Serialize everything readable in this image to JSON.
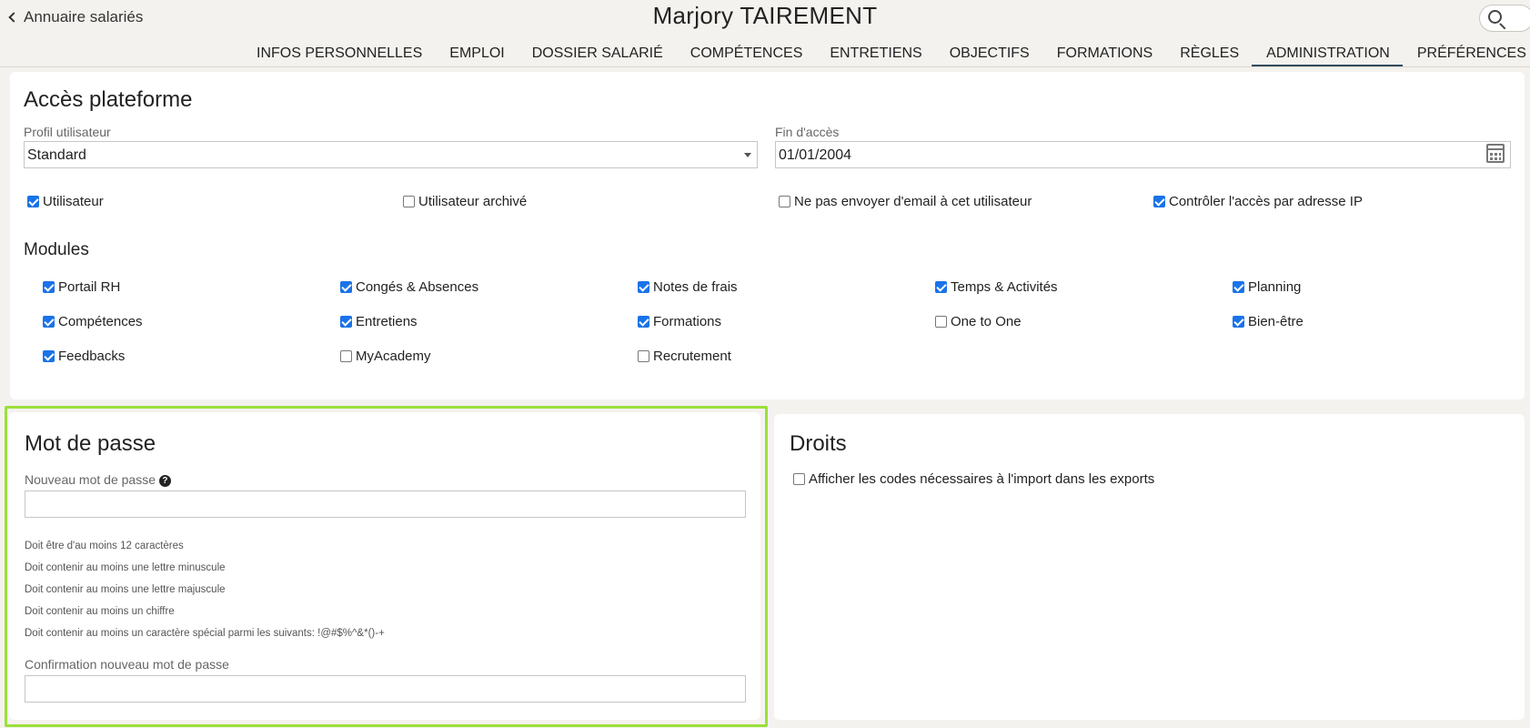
{
  "header": {
    "back_label": "Annuaire salariés",
    "person_name": "Marjory TAIREMENT",
    "tabs": [
      {
        "label": "INFOS PERSONNELLES",
        "active": false
      },
      {
        "label": "EMPLOI",
        "active": false
      },
      {
        "label": "DOSSIER SALARIÉ",
        "active": false
      },
      {
        "label": "COMPÉTENCES",
        "active": false
      },
      {
        "label": "ENTRETIENS",
        "active": false
      },
      {
        "label": "OBJECTIFS",
        "active": false
      },
      {
        "label": "FORMATIONS",
        "active": false
      },
      {
        "label": "RÈGLES",
        "active": false
      },
      {
        "label": "ADMINISTRATION",
        "active": true
      },
      {
        "label": "PRÉFÉRENCES",
        "active": false
      }
    ]
  },
  "access": {
    "title": "Accès plateforme",
    "profile_label": "Profil utilisateur",
    "profile_value": "Standard",
    "end_label": "Fin d'accès",
    "end_value": "01/01/2004",
    "options": [
      {
        "label": "Utilisateur",
        "checked": true
      },
      {
        "label": "Utilisateur archivé",
        "checked": false
      },
      {
        "label": "Ne pas envoyer d'email à cet utilisateur",
        "checked": false
      },
      {
        "label": "Contrôler l'accès par adresse IP",
        "checked": true
      }
    ],
    "modules_title": "Modules",
    "modules": [
      {
        "label": "Portail RH",
        "checked": true
      },
      {
        "label": "Congés & Absences",
        "checked": true
      },
      {
        "label": "Notes de frais",
        "checked": true
      },
      {
        "label": "Temps & Activités",
        "checked": true
      },
      {
        "label": "Planning",
        "checked": true
      },
      {
        "label": "Compétences",
        "checked": true
      },
      {
        "label": "Entretiens",
        "checked": true
      },
      {
        "label": "Formations",
        "checked": true
      },
      {
        "label": "One to One",
        "checked": false
      },
      {
        "label": "Bien-être",
        "checked": true
      },
      {
        "label": "Feedbacks",
        "checked": true
      },
      {
        "label": "MyAcademy",
        "checked": false
      },
      {
        "label": "Recrutement",
        "checked": false
      }
    ]
  },
  "password": {
    "title": "Mot de passe",
    "new_label": "Nouveau mot de passe",
    "new_value": "",
    "help_glyph": "?",
    "rules": [
      "Doit être d'au moins 12 caractères",
      "Doit contenir au moins une lettre minuscule",
      "Doit contenir au moins une lettre majuscule",
      "Doit contenir au moins un chiffre",
      "Doit contenir au moins un caractère spécial parmi les suivants: !@#$%^&*()-+"
    ],
    "confirm_label": "Confirmation nouveau mot de passe",
    "confirm_value": ""
  },
  "rights": {
    "title": "Droits",
    "options": [
      {
        "label": "Afficher les codes nécessaires à l'import dans les exports",
        "checked": false
      }
    ]
  },
  "colors": {
    "accent": "#1a73e8",
    "highlight": "#9be03a",
    "tab_underline": "#2f4a5e",
    "background": "#f4f2ee"
  }
}
